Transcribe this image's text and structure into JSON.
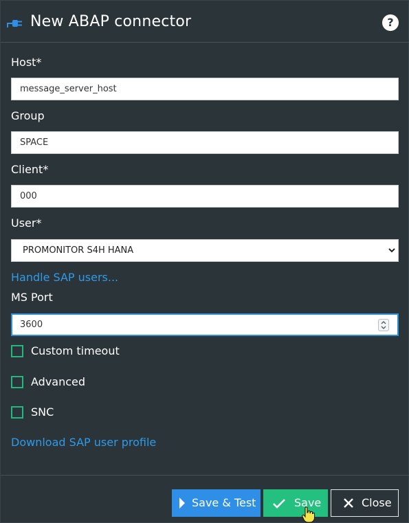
{
  "dialog": {
    "title": "New ABAP connector",
    "title_icon": "plug-icon",
    "help_label": "?"
  },
  "form": {
    "host": {
      "label": "Host*",
      "value": "message_server_host"
    },
    "group": {
      "label": "Group",
      "value": "SPACE"
    },
    "client": {
      "label": "Client*",
      "value": "000"
    },
    "user": {
      "label": "User*",
      "selected": "PROMONITOR S4H HANA"
    },
    "handle_users_link": "Handle SAP users...",
    "ms_port": {
      "label": "MS Port",
      "value": "3600"
    },
    "checkboxes": [
      {
        "label": "Custom timeout",
        "checked": false
      },
      {
        "label": "Advanced",
        "checked": false
      },
      {
        "label": "SNC",
        "checked": false
      }
    ],
    "download_link": "Download SAP user profile"
  },
  "footer": {
    "save_test_label": "Save & Test",
    "save_label": "Save",
    "close_label": "Close"
  },
  "colors": {
    "background": "#2b3439",
    "accent_blue": "#2f8fe6",
    "accent_green": "#23c07f",
    "link": "#2f9ae8"
  }
}
